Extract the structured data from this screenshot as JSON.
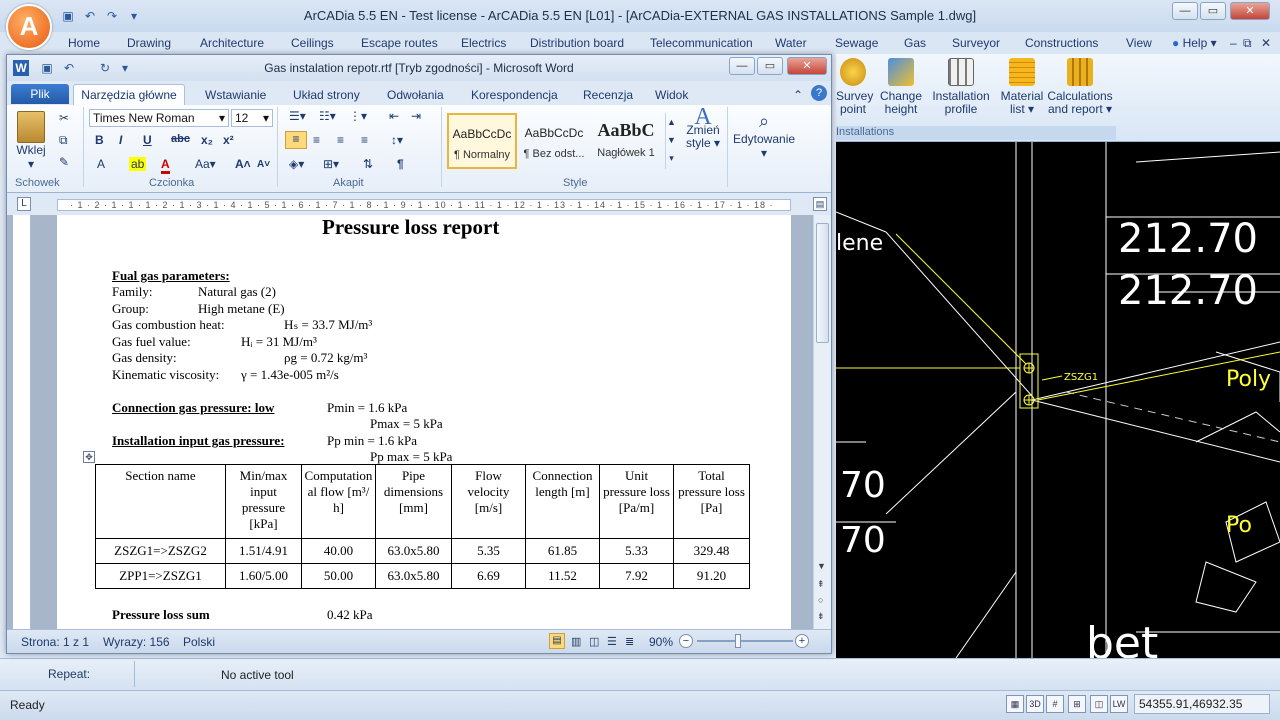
{
  "app": {
    "logo": "A",
    "title": "ArCADia 5.5 EN - Test license - ArCADia 5.5 EN [L01] - [ArCADia-EXTERNAL GAS INSTALLATIONS Sample 1.dwg]",
    "tabs": [
      "Home",
      "Drawing",
      "Architecture",
      "Ceilings",
      "Escape routes",
      "Electrics",
      "Distribution board",
      "Telecommunication",
      "Water",
      "Sewage",
      "Gas",
      "Surveyor",
      "Constructions",
      "View"
    ],
    "help": "Help",
    "gas_buttons": [
      {
        "label": "Survey point"
      },
      {
        "label": "Change height"
      },
      {
        "label": "Installation profile"
      },
      {
        "label": "Material list"
      },
      {
        "label": "Calculations and report"
      }
    ],
    "gas_group": "Installations",
    "repeat_label": "Repeat:",
    "active_tool": "No active tool",
    "status": "Ready",
    "coords": "54355.91,46932.35"
  },
  "cad": {
    "texts": [
      "212.70",
      "212.70",
      "lene",
      "ZSZG1",
      "Poly",
      "Po",
      "bet",
      "70",
      "70"
    ]
  },
  "word": {
    "title": "Gas instalation repotr.rtf [Tryb zgodności] - Microsoft Word",
    "file_tab": "Plik",
    "tabs": [
      "Narzędzia główne",
      "Wstawianie",
      "Układ strony",
      "Odwołania",
      "Korespondencja",
      "Recenzja",
      "Widok"
    ],
    "font": "Times New Roman",
    "size": "12",
    "groups": [
      "Schowek",
      "Czcionka",
      "Akapit",
      "Style"
    ],
    "paste": "Wklej",
    "styles": [
      {
        "preview": "AaBbCcDc",
        "name": "¶ Normalny"
      },
      {
        "preview": "AaBbCcDc",
        "name": "¶ Bez odst..."
      },
      {
        "preview": "AaBbC",
        "name": "Nagłówek 1"
      }
    ],
    "change_styles": "Zmień style",
    "editing": "Edytowanie",
    "status": {
      "page": "Strona: 1 z 1",
      "words": "Wyrazy: 156",
      "lang": "Polski",
      "zoom": "90%"
    }
  },
  "report": {
    "heading": "Pressure loss report",
    "fuel_title": "Fual gas parameters:",
    "family_label": "Family:",
    "family_value": "Natural gas (2)",
    "group_label": "Group:",
    "group_value": "High metane (E)",
    "comb_label": "Gas combustion heat:",
    "comb_value": "Hₛ = 33.7 MJ/m³",
    "fuel_label": "Gas fuel value:",
    "fuel_value": "Hᵢ = 31 MJ/m³",
    "density_label": "Gas density:",
    "density_value": "ρg = 0.72 kg/m³",
    "visc_label": "Kinematic viscosity:",
    "visc_value": "γ = 1.43e-005 m²/s",
    "conn_title": "Connection gas pressure: low",
    "conn_min": "Pmin = 1.6 kPa",
    "conn_max": "Pmax = 5 kPa",
    "inst_title": "Installation input gas pressure:",
    "inst_min": "Pp min = 1.6 kPa",
    "inst_max": "Pp max = 5 kPa",
    "columns": [
      "Section name",
      "Min/max input pressure [kPa]",
      "Computational flow [m³/h]",
      "Pipe dimensions [mm]",
      "Flow velocity [m/s]",
      "Connection length [m]",
      "Unit pressure loss [Pa/m]",
      "Total pressure loss [Pa]"
    ],
    "rows": [
      [
        "ZSZG1=>ZSZG2",
        "1.51/4.91",
        "40.00",
        "63.0x5.80",
        "5.35",
        "61.85",
        "5.33",
        "329.48"
      ],
      [
        "ZPP1=>ZSZG1",
        "1.60/5.00",
        "50.00",
        "63.0x5.80",
        "6.69",
        "11.52",
        "7.92",
        "91.20"
      ]
    ],
    "sum_label": "Pressure loss sum",
    "sum_value": "0.42 kPa"
  }
}
